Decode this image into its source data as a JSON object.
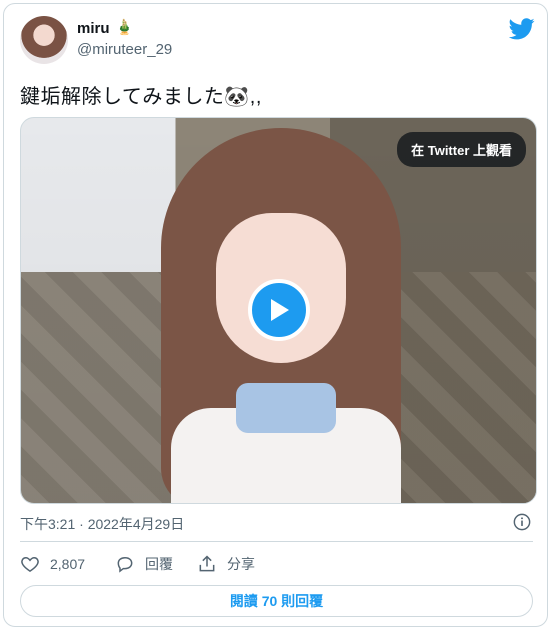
{
  "author": {
    "display_name": "miru",
    "name_emoji": "🎍",
    "handle": "@miruteer_29"
  },
  "tweet": {
    "text": "鍵垢解除してみました🐼,,"
  },
  "media": {
    "watch_on_twitter_label": "在 Twitter 上觀看"
  },
  "meta": {
    "timestamp": "下午3:21 · 2022年4月29日"
  },
  "actions": {
    "like_count": "2,807",
    "reply_label": "回覆",
    "share_label": "分享"
  },
  "footer": {
    "read_replies_label": "閱讀 70 則回覆"
  },
  "colors": {
    "brand": "#1d9bf0",
    "secondary_text": "#536471"
  }
}
